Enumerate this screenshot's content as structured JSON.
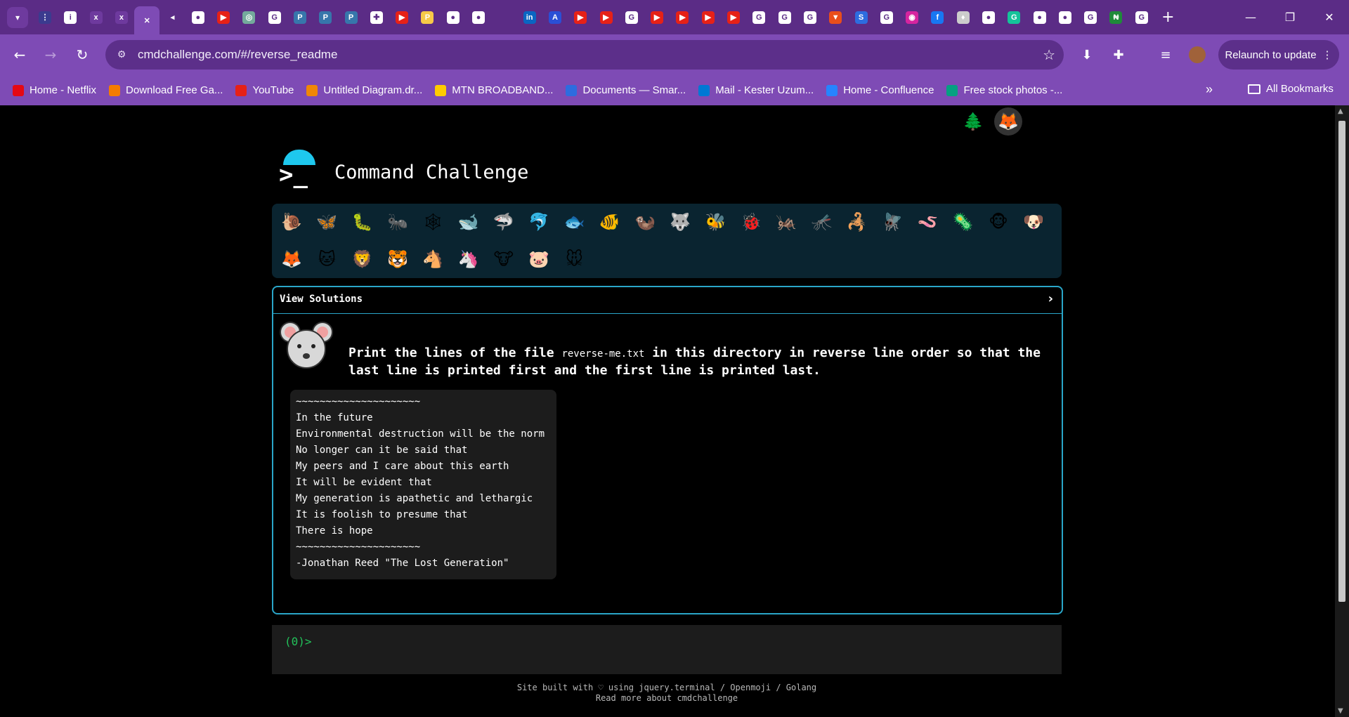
{
  "browser": {
    "tabs": [
      {
        "icon": "dots-icon",
        "color": "#3b3b8f",
        "glyph": "⋮"
      },
      {
        "icon": "info-icon",
        "color": "#ffffff",
        "glyph": "i"
      },
      {
        "icon": "alx-icon",
        "color": "#6e3a9e",
        "glyph": "x"
      },
      {
        "icon": "alx-icon",
        "color": "#6e3a9e",
        "glyph": "x"
      },
      {
        "icon": "close-icon",
        "color": "#7e4bb5",
        "glyph": "✕"
      },
      {
        "icon": "speaker-icon",
        "color": "#5b2c86",
        "glyph": "◂"
      },
      {
        "icon": "github-icon",
        "color": "#ffffff",
        "glyph": "●"
      },
      {
        "icon": "youtube-icon",
        "color": "#e62117",
        "glyph": "▶"
      },
      {
        "icon": "chatgpt-icon",
        "color": "#74aa9c",
        "glyph": "◎"
      },
      {
        "icon": "google-icon",
        "color": "#ffffff",
        "glyph": "G"
      },
      {
        "icon": "python-icon",
        "color": "#3776ab",
        "glyph": "P"
      },
      {
        "icon": "python-icon",
        "color": "#3776ab",
        "glyph": "P"
      },
      {
        "icon": "python-icon",
        "color": "#3776ab",
        "glyph": "P"
      },
      {
        "icon": "puzzle-icon",
        "color": "#ffffff",
        "glyph": "✚"
      },
      {
        "icon": "youtube-icon",
        "color": "#e62117",
        "glyph": "▶"
      },
      {
        "icon": "python-icon",
        "color": "#f7c948",
        "glyph": "P"
      },
      {
        "icon": "github-icon",
        "color": "#ffffff",
        "glyph": "●"
      },
      {
        "icon": "github-icon",
        "color": "#ffffff",
        "glyph": "●"
      },
      {
        "icon": "blank-icon",
        "color": "#5b2c86",
        "glyph": ""
      },
      {
        "icon": "linkedin-icon",
        "color": "#0a66c2",
        "glyph": "in"
      },
      {
        "icon": "a-icon",
        "color": "#2a4fd6",
        "glyph": "A"
      },
      {
        "icon": "youtube-icon",
        "color": "#e62117",
        "glyph": "▶"
      },
      {
        "icon": "youtube-icon",
        "color": "#e62117",
        "glyph": "▶"
      },
      {
        "icon": "google-icon",
        "color": "#ffffff",
        "glyph": "G"
      },
      {
        "icon": "youtube-icon",
        "color": "#e62117",
        "glyph": "▶"
      },
      {
        "icon": "youtube-icon",
        "color": "#e62117",
        "glyph": "▶"
      },
      {
        "icon": "youtube-icon",
        "color": "#e62117",
        "glyph": "▶"
      },
      {
        "icon": "youtube-icon",
        "color": "#e62117",
        "glyph": "▶"
      },
      {
        "icon": "google-icon",
        "color": "#ffffff",
        "glyph": "G"
      },
      {
        "icon": "google-icon",
        "color": "#ffffff",
        "glyph": "G"
      },
      {
        "icon": "google-icon",
        "color": "#ffffff",
        "glyph": "G"
      },
      {
        "icon": "flag-icon",
        "color": "#e94e1b",
        "glyph": "▼"
      },
      {
        "icon": "s-icon",
        "color": "#2d6cdf",
        "glyph": "S"
      },
      {
        "icon": "google-icon",
        "color": "#ffffff",
        "glyph": "G"
      },
      {
        "icon": "instagram-icon",
        "color": "#d6249f",
        "glyph": "◉"
      },
      {
        "icon": "facebook-icon",
        "color": "#1877f2",
        "glyph": "f"
      },
      {
        "icon": "handshake-icon",
        "color": "#cccccc",
        "glyph": "♦"
      },
      {
        "icon": "github-icon",
        "color": "#ffffff",
        "glyph": "●"
      },
      {
        "icon": "grammarly-icon",
        "color": "#15c39a",
        "glyph": "G"
      },
      {
        "icon": "key-icon",
        "color": "#ffffff",
        "glyph": "●"
      },
      {
        "icon": "github-icon",
        "color": "#ffffff",
        "glyph": "●"
      },
      {
        "icon": "google-icon",
        "color": "#ffffff",
        "glyph": "G"
      },
      {
        "icon": "naira-icon",
        "color": "#1f8a3a",
        "glyph": "₦"
      },
      {
        "icon": "google-icon",
        "color": "#ffffff",
        "glyph": "G"
      }
    ],
    "new_tab": "+",
    "url": "cmdchallenge.com/#/reverse_readme",
    "relaunch_label": "Relaunch to update",
    "bookmarks": [
      {
        "label": "Home - Netflix",
        "color": "#e50914"
      },
      {
        "label": "Download Free Ga...",
        "color": "#f57c00"
      },
      {
        "label": "YouTube",
        "color": "#e62117"
      },
      {
        "label": "Untitled Diagram.dr...",
        "color": "#f08705"
      },
      {
        "label": "MTN BROADBAND...",
        "color": "#ffcc00"
      },
      {
        "label": "Documents — Smar...",
        "color": "#2d6cdf"
      },
      {
        "label": "Mail - Kester Uzum...",
        "color": "#0078d4"
      },
      {
        "label": "Home - Confluence",
        "color": "#2684ff"
      },
      {
        "label": "Free stock photos -...",
        "color": "#05a081"
      }
    ],
    "all_bookmarks": "All Bookmarks"
  },
  "page": {
    "title": "Command Challenge",
    "view_solutions": "View Solutions",
    "task_before": "Print the lines of the file ",
    "task_file": "reverse-me.txt",
    "task_after": " in this directory in reverse line order so that the last line is printed first and the first line is printed last.",
    "poem_lines": [
      "~~~~~~~~~~~~~~~~~~~~~",
      "In the future",
      "Environmental destruction will be the norm",
      "No longer can it be said that",
      "My peers and I care about this earth",
      "It will be evident that",
      "My generation is apathetic and lethargic",
      "It is foolish to presume that",
      "There is hope",
      "~~~~~~~~~~~~~~~~~~~~~",
      "-Jonathan Reed \"The Lost Generation\""
    ],
    "prompt": "(0)>",
    "footer_line1": "Site built with ♡ using jquery.terminal / Openmoji / Golang",
    "footer_line2": "Read more about cmdchallenge"
  },
  "header_icons": [
    {
      "name": "terminal-icon",
      "glyph": "≻",
      "bg": "#000000"
    },
    {
      "name": "shush-emoji-icon",
      "glyph": "😗",
      "bg": "#000000"
    },
    {
      "name": "tree-icon",
      "glyph": "🌲",
      "bg": "#000000"
    },
    {
      "name": "gitlab-icon",
      "glyph": "🦊",
      "bg": "#333333"
    },
    {
      "name": "mail-icon",
      "glyph": "✉",
      "bg": "#000000"
    }
  ],
  "animals": [
    {
      "name": "snail-icon",
      "glyph": "🐌"
    },
    {
      "name": "butterfly-icon",
      "glyph": "🦋"
    },
    {
      "name": "bug-icon",
      "glyph": "🐛"
    },
    {
      "name": "ant-icon",
      "glyph": "🐜"
    },
    {
      "name": "spider-web-icon",
      "glyph": "🕸"
    },
    {
      "name": "whale-icon",
      "glyph": "🐋"
    },
    {
      "name": "shark-icon",
      "glyph": "🦈"
    },
    {
      "name": "dolphin-icon",
      "glyph": "🐬"
    },
    {
      "name": "fish-icon",
      "glyph": "🐟"
    },
    {
      "name": "tropical-fish-icon",
      "glyph": "🐠"
    },
    {
      "name": "otter-icon",
      "glyph": "🦦"
    },
    {
      "name": "wolf-icon",
      "glyph": "🐺"
    },
    {
      "name": "bee-icon",
      "glyph": "🐝"
    },
    {
      "name": "ladybug-icon",
      "glyph": "🐞"
    },
    {
      "name": "leaf-bug-icon",
      "glyph": "🦗"
    },
    {
      "name": "mosquito-icon",
      "glyph": "🦟"
    },
    {
      "name": "scorpion-icon",
      "glyph": "🦂"
    },
    {
      "name": "fly-icon",
      "glyph": "🪰"
    },
    {
      "name": "worm-icon",
      "glyph": "🪱"
    },
    {
      "name": "microbe-icon",
      "glyph": "🦠"
    },
    {
      "name": "monkey-icon",
      "glyph": "🐵"
    },
    {
      "name": "dog-icon",
      "glyph": "🐶"
    },
    {
      "name": "fox-icon",
      "glyph": "🦊"
    },
    {
      "name": "cat-icon",
      "glyph": "🐱"
    },
    {
      "name": "lion-icon",
      "glyph": "🦁"
    },
    {
      "name": "tiger-icon",
      "glyph": "🐯"
    },
    {
      "name": "horse-icon",
      "glyph": "🐴"
    },
    {
      "name": "unicorn-icon",
      "glyph": "🦄"
    },
    {
      "name": "cow-icon",
      "glyph": "🐮"
    },
    {
      "name": "pig-icon",
      "glyph": "🐷"
    },
    {
      "name": "mouse-icon",
      "glyph": "🐭"
    }
  ],
  "colors": {
    "tabstrip": "#5b2c86",
    "toolbar": "#7e4bb5",
    "panel_border": "#2aa6c9",
    "prompt_green": "#22c25a"
  }
}
